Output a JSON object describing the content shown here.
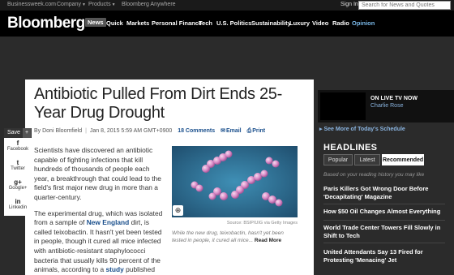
{
  "topbar": {
    "items": [
      "Businessweek.com",
      "Company",
      "Products",
      "Bloomberg Anywhere"
    ],
    "signin": "Sign In",
    "search_placeholder": "Search for News and Quotes"
  },
  "nav": {
    "logo": "Bloomberg",
    "items": [
      "News",
      "Quick",
      "Markets",
      "Personal Finance",
      "Tech",
      "U.S. Politics",
      "Sustainability",
      "Luxury",
      "Video",
      "Radio",
      "Opinion"
    ]
  },
  "article": {
    "headline": "Antibiotic Pulled From Dirt Ends 25-Year Drug Drought",
    "byline_author": "By Doni Bloomfield",
    "byline_date": "Jan 8, 2015 5:59 AM GMT+0900",
    "comments": "18 Comments",
    "email": "Email",
    "print": "Print",
    "para1": "Scientists have discovered an antibiotic capable of fighting infections that kill hundreds of thousands of people each year, a breakthrough that could lead to the field's first major new drug in more than a quarter-century.",
    "para2_a": "The experimental drug, which was isolated from a sample of ",
    "para2_link1": "New England",
    "para2_b": " dirt, is called teixobactin. It hasn't yet been tested in people, though it cured all mice infected with antibiotic-resistant staphylococci bacteria that usually kills 90 percent of the animals, according to a ",
    "para2_link2": "study",
    "para2_c": " published",
    "image_credit": "Source: BSIP/UIG via Getty Images",
    "caption": "While the new drug, teixobactin, hasn't yet been tested in people, it cured all mice...",
    "read_more": "Read More"
  },
  "share": {
    "save": "Save",
    "plus": "+",
    "items": [
      {
        "label": "Facebook",
        "icon": "f"
      },
      {
        "label": "Twitter",
        "icon": "t"
      },
      {
        "label": "Google+",
        "icon": "g+"
      },
      {
        "label": "Linkedin",
        "icon": "in"
      }
    ]
  },
  "sidebar": {
    "tv_label": "ON LIVE TV NOW",
    "tv_show": "Charlie Rose",
    "more_shows": "See More of Today's Schedule",
    "headlines_title": "HEADLINES",
    "tabs": [
      "Popular",
      "Latest",
      "Recommended"
    ],
    "active_tab": "Recommended",
    "based_on": "Based on your reading history you may like",
    "stories": [
      "Paris Killers Got Wrong Door Before 'Decapitating' Magazine",
      "How $50 Oil Changes Almost Everything",
      "World Trade Center Towers Fill Slowly in Shift to Tech",
      "United Attendants Say 13 Fired for Protesting 'Menacing' Jet"
    ]
  },
  "colors": {
    "accent_link": "#1a4f8c",
    "opinion": "#7ab8e8",
    "page_bg": "#2b2b2b"
  }
}
